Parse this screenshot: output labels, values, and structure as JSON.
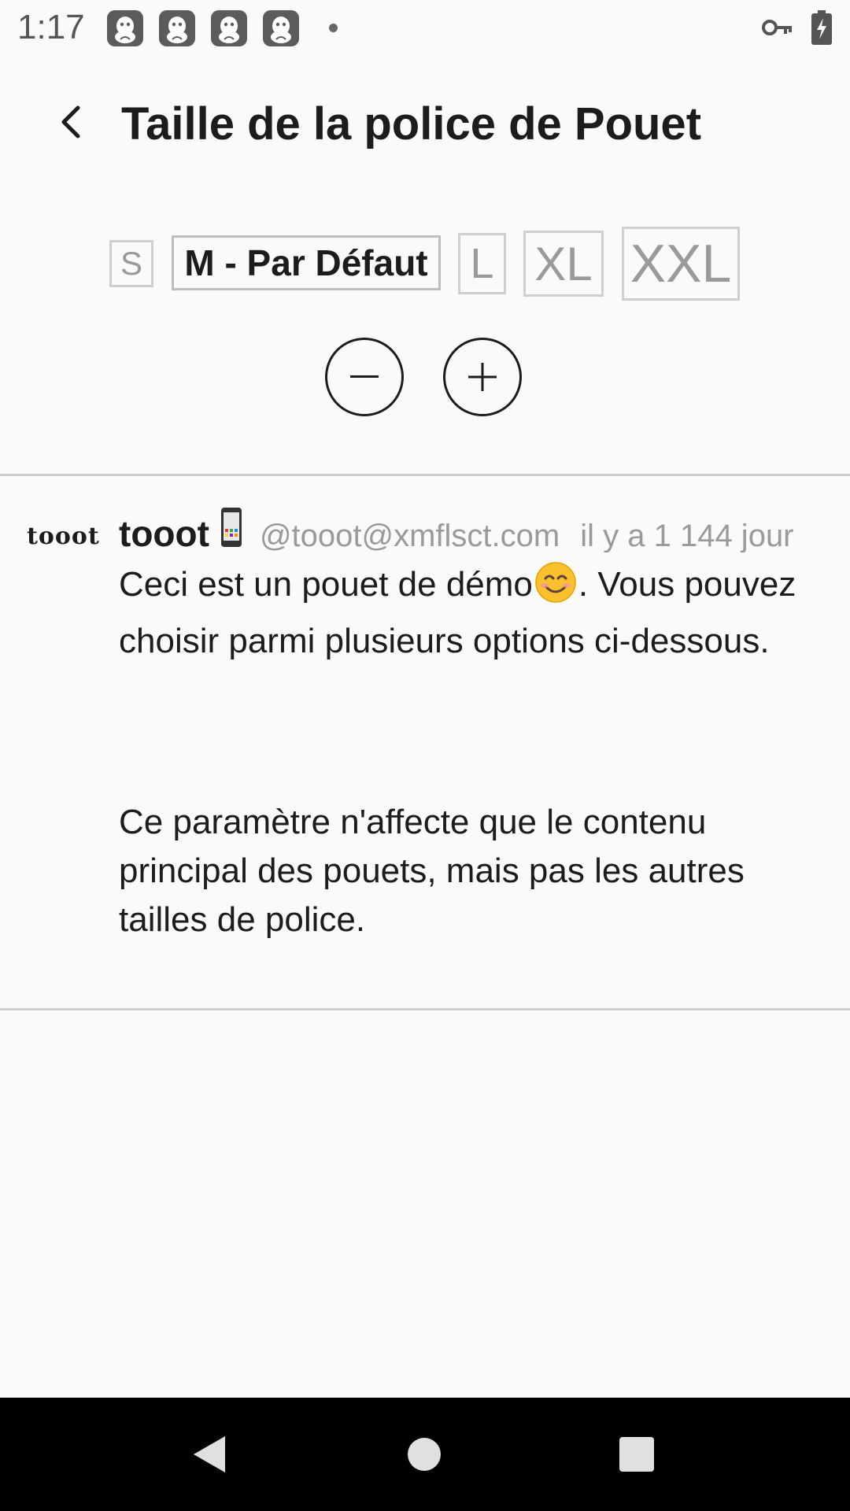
{
  "status_bar": {
    "time": "1:17",
    "notification_icons": [
      "mastodon-app-icon",
      "mastodon-app-icon",
      "mastodon-app-icon",
      "mastodon-app-icon"
    ],
    "indicators": [
      "vpn-key-icon",
      "battery-charging-icon"
    ]
  },
  "header": {
    "back_icon": "chevron-left-icon",
    "title": "Taille de la police de Pouet"
  },
  "size_options": {
    "s": "S",
    "m": "M - Par Défaut",
    "l": "L",
    "xl": "XL",
    "xxl": "XXL",
    "selected": "M - Par Défaut"
  },
  "controls": {
    "decrease_icon": "minus-icon",
    "increase_icon": "plus-icon"
  },
  "toot": {
    "avatar_text": "tooot",
    "display_name": "tooot",
    "account": "@tooot@xmflsct.com",
    "time": "il y a 1 144 jour",
    "paragraph1_before": "Ceci est un pouet de démo",
    "paragraph1_after": ". Vous pouvez choisir parmi plusieurs options ci-dessous.",
    "paragraph2": "Ce paramètre n'affecte que le contenu principal des pouets, mais pas les autres tailles de police."
  },
  "navigation": {
    "back_icon": "nav-back-triangle-icon",
    "home_icon": "nav-home-circle-icon",
    "recent_icon": "nav-recent-square-icon"
  },
  "colors": {
    "background": "#fafafa",
    "text": "#1c1c1c",
    "muted": "#9a9a9a",
    "border": "#cfcfcf",
    "nav_bar": "#000000"
  }
}
